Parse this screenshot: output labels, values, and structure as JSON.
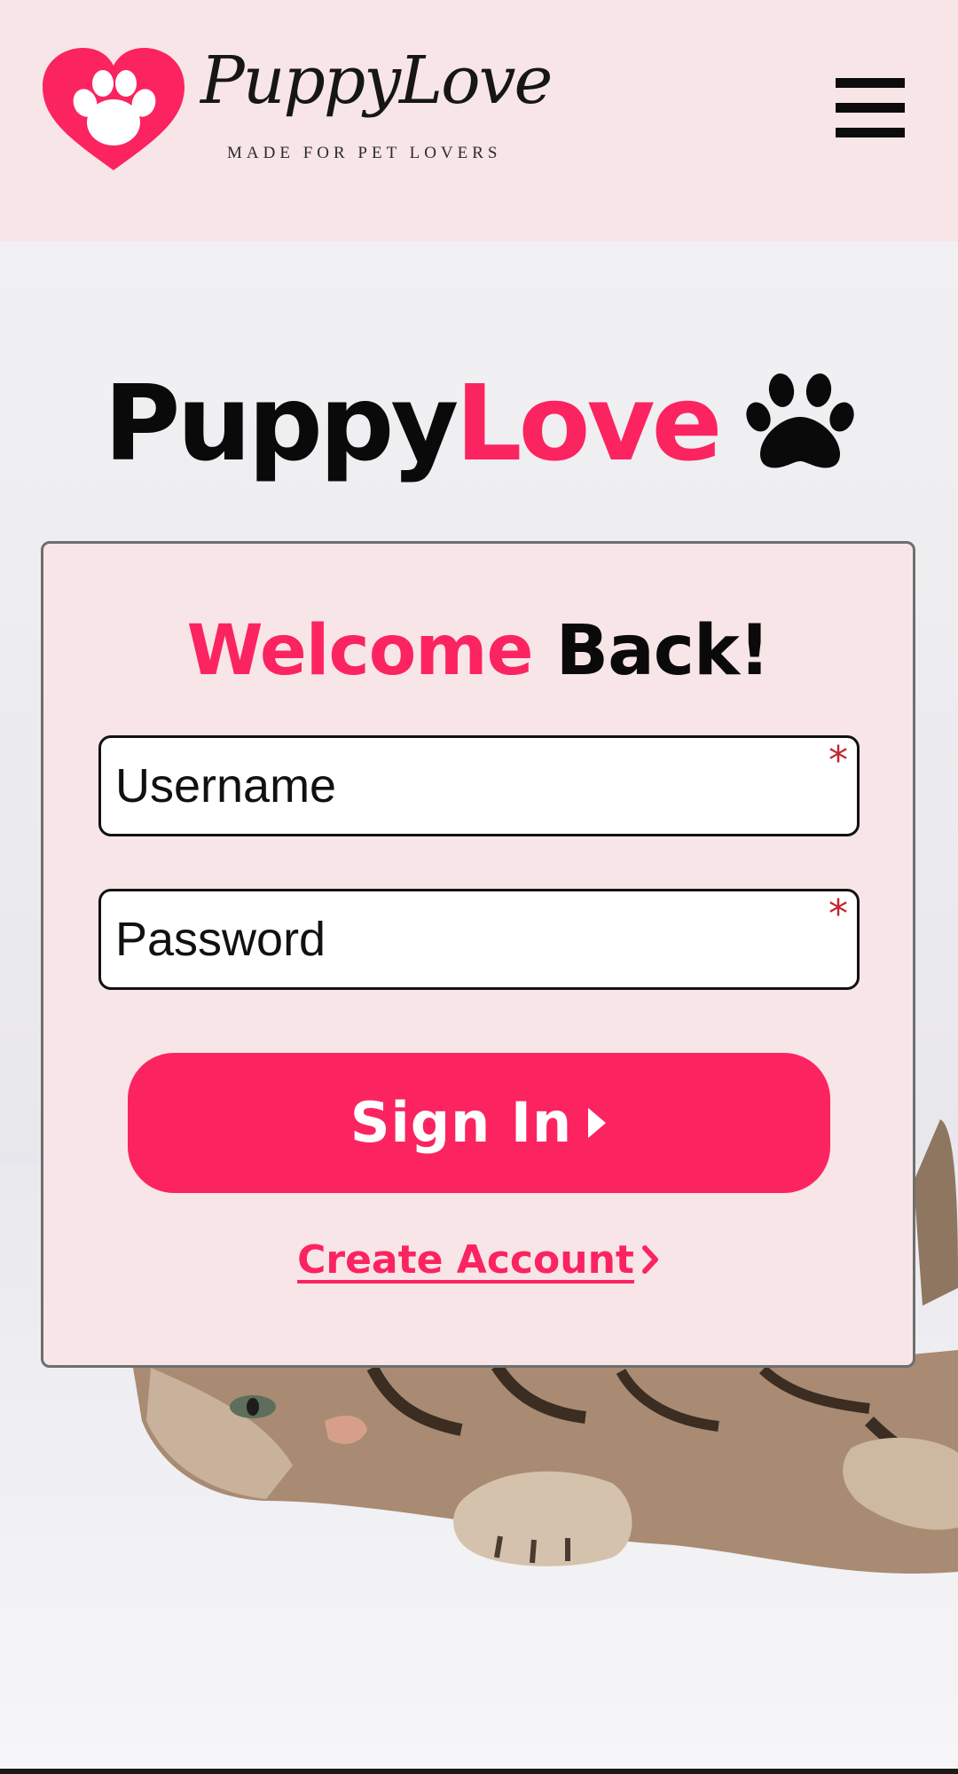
{
  "header": {
    "logo_text": "PuppyLove",
    "tagline": "MADE FOR PET LOVERS",
    "menu_icon": "hamburger-menu-icon"
  },
  "hero": {
    "title_part1": "Puppy",
    "title_part2": "Love",
    "icon": "paw-icon"
  },
  "login": {
    "heading_part1": "Welcome",
    "heading_part2": "Back!",
    "username_placeholder": "Username",
    "username_value": "",
    "password_placeholder": "Password",
    "password_value": "",
    "required_marker": "*",
    "signin_label": "Sign In",
    "create_account_label": "Create Account"
  },
  "colors": {
    "accent": "#fb2460",
    "header_bg": "#f8e5e7",
    "card_bg": "#f8e5e7",
    "required": "#c2272d",
    "text": "#0a0a0a"
  },
  "background": "tabby-kitten-photo"
}
